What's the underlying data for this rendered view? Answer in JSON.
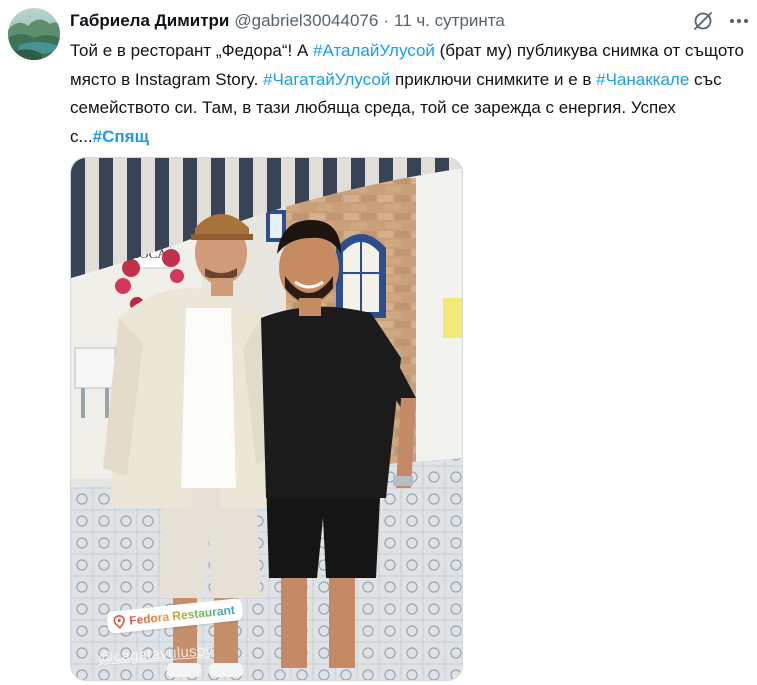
{
  "tweet": {
    "author": {
      "display_name": "Габриела Димитри",
      "handle": "@gabriel30044076",
      "separator": "·",
      "time": "11 ч. сутринта"
    },
    "icons": {
      "grok": "grok-icon",
      "more": "more-icon"
    },
    "text": {
      "p1": "Той е в ресторант „Федора“! А ",
      "tag1": "#АталайУлусой",
      "p2": " (брат му) публикува снимка от същото място в Instagram Story. ",
      "tag2": "#ЧагатайУлусой",
      "p3": " приключи снимките и е в ",
      "tag3": "#Чанаккале",
      "p4": " със семейството си. Там, в тази любяща среда, той се зарежда с енергия. Успех с...",
      "tag4": "#Спящ"
    },
    "media": {
      "sticker_location": "Fedora Restaurant",
      "sticker_mention": "@cagatayulusoy",
      "sign": "LOCA"
    },
    "colors": {
      "accent": "#1d9bf0",
      "secondary_text": "#536471",
      "primary_text": "#0f1419"
    }
  }
}
